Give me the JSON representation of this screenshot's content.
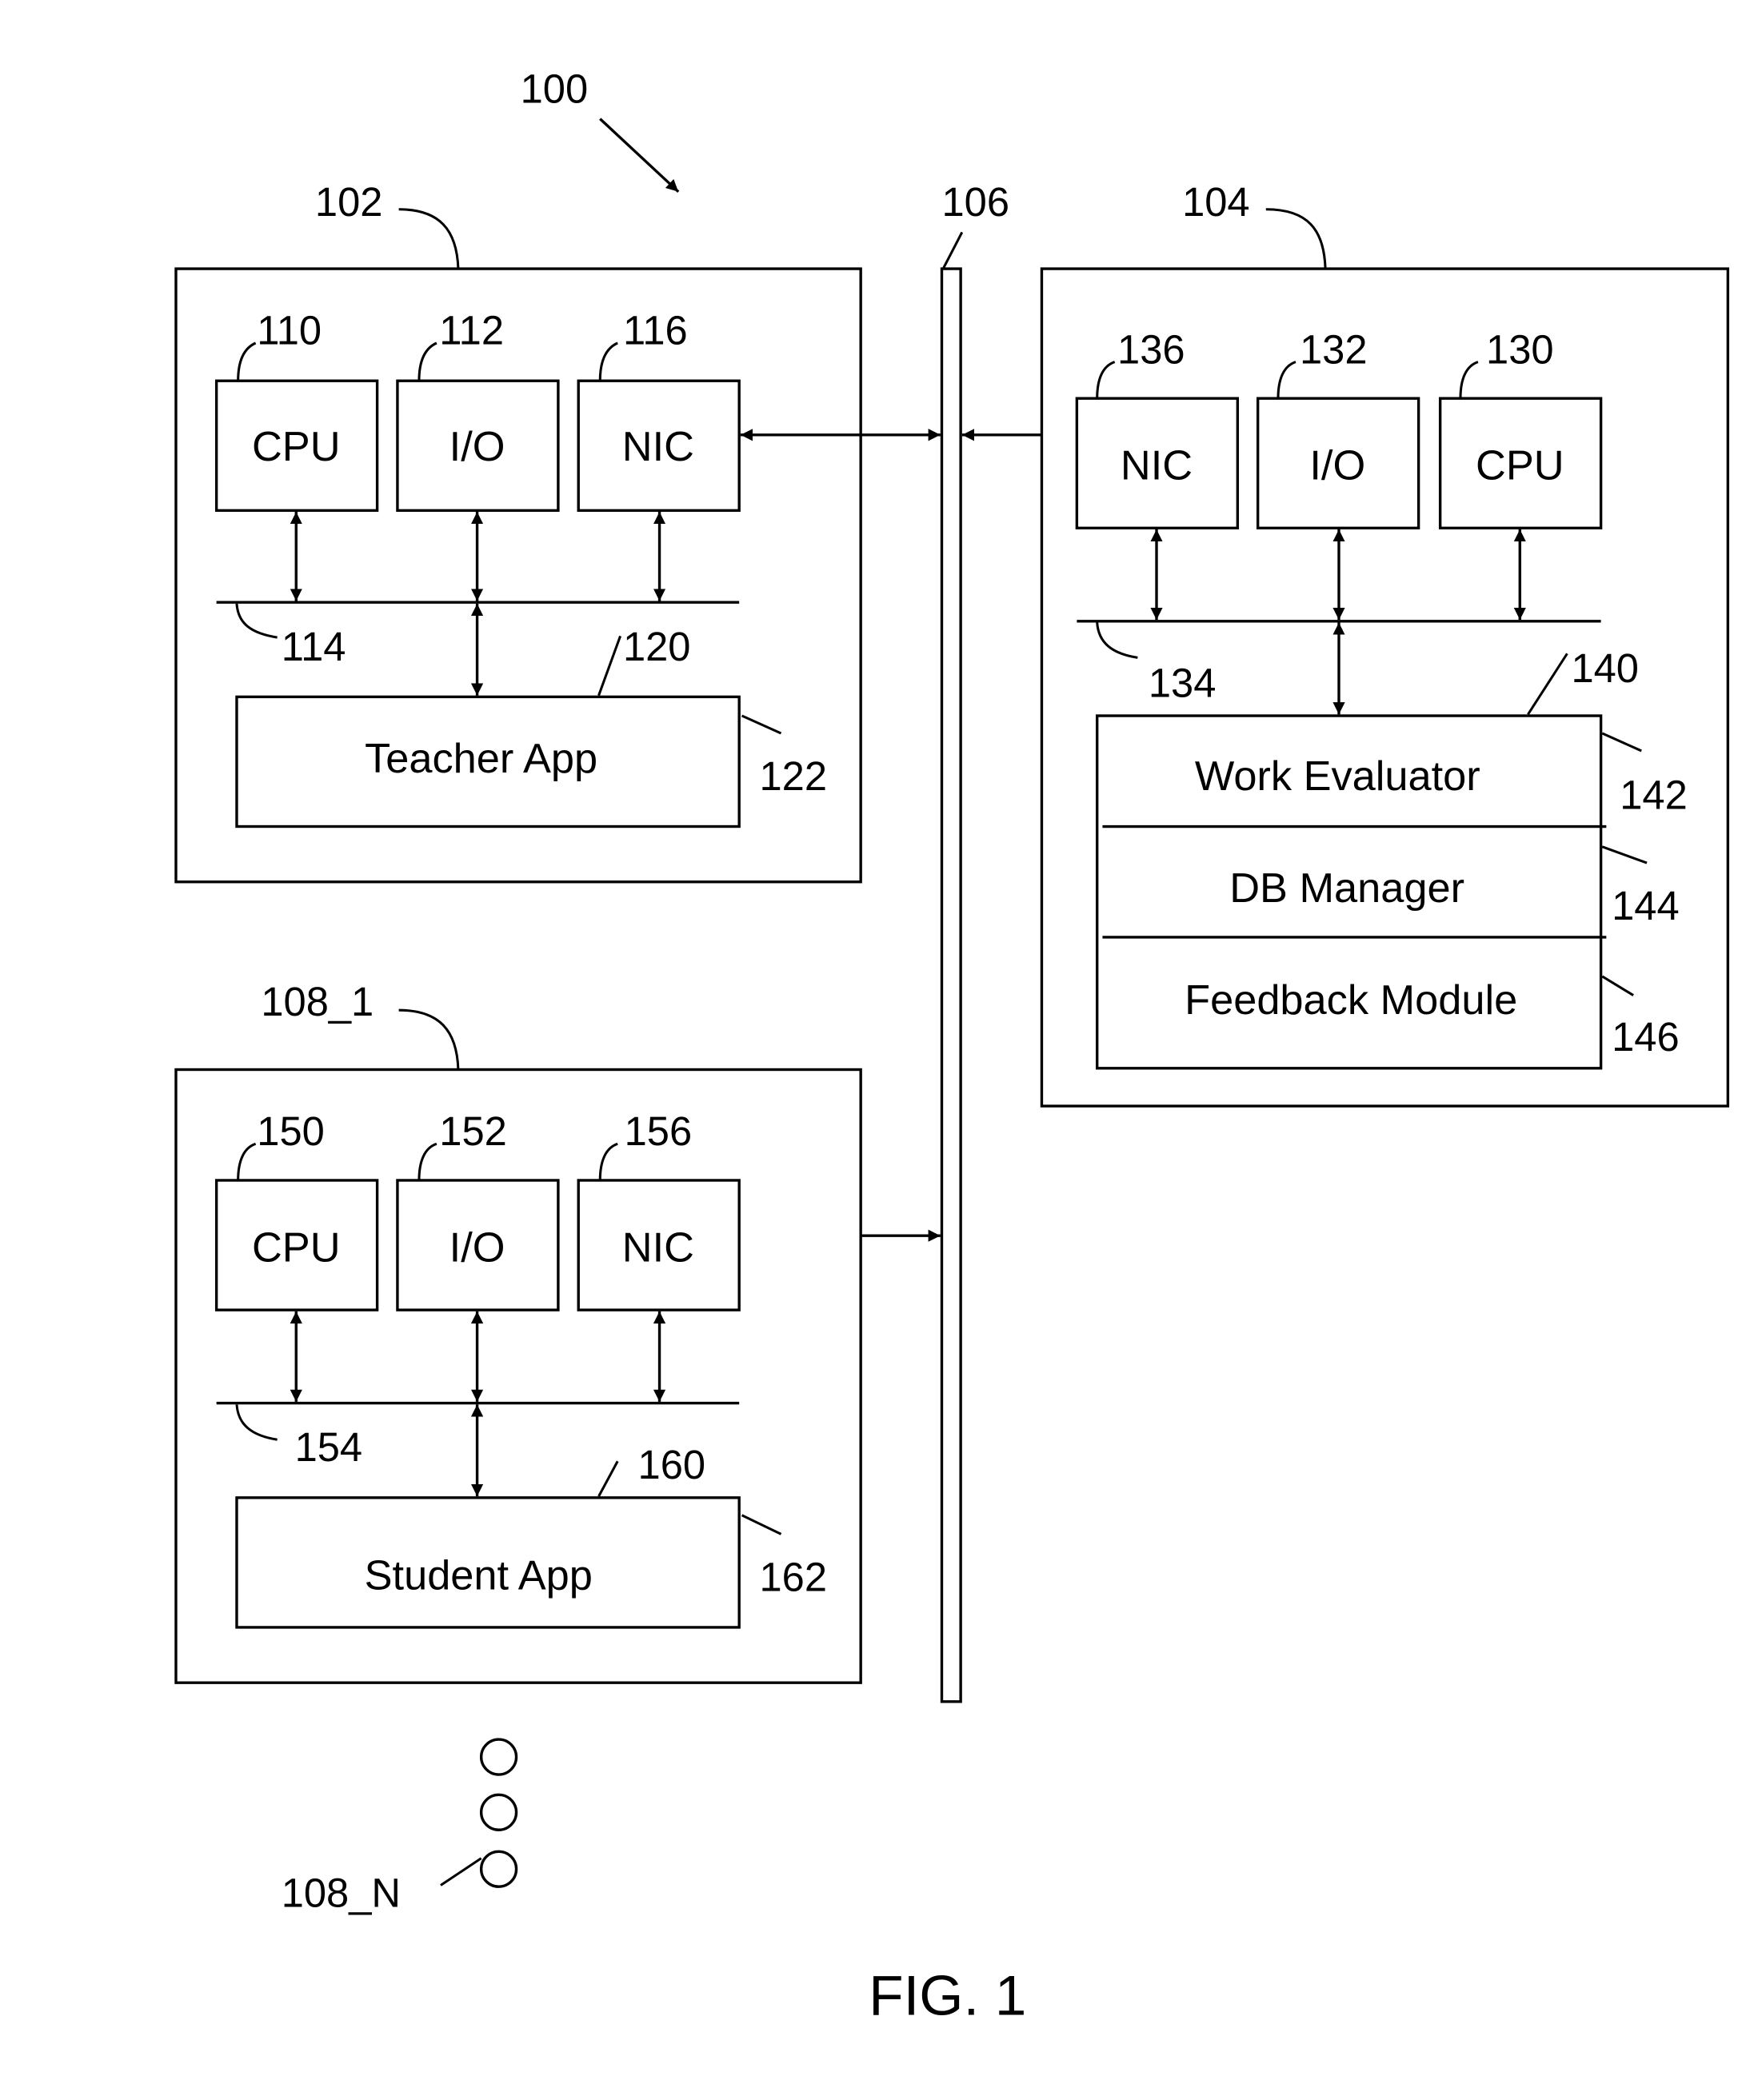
{
  "figure": {
    "caption": "FIG. 1",
    "system_ref": "100",
    "network": {
      "ref": "106"
    },
    "teacher_device": {
      "ref": "102",
      "components": [
        {
          "ref": "110",
          "label": "CPU"
        },
        {
          "ref": "112",
          "label": "I/O"
        },
        {
          "ref": "116",
          "label": "NIC"
        }
      ],
      "bus_ref": "114",
      "memory_ref": "120",
      "app": {
        "ref": "122",
        "label": "Teacher App"
      }
    },
    "server": {
      "ref": "104",
      "components": [
        {
          "ref": "136",
          "label": "NIC"
        },
        {
          "ref": "132",
          "label": "I/O"
        },
        {
          "ref": "130",
          "label": "CPU"
        }
      ],
      "bus_ref": "134",
      "memory_ref": "140",
      "modules": [
        {
          "ref": "142",
          "label": "Work Evaluator"
        },
        {
          "ref": "144",
          "label": "DB Manager"
        },
        {
          "ref": "146",
          "label": "Feedback Module"
        }
      ]
    },
    "student_device": {
      "ref": "108_1",
      "components": [
        {
          "ref": "150",
          "label": "CPU"
        },
        {
          "ref": "152",
          "label": "I/O"
        },
        {
          "ref": "156",
          "label": "NIC"
        }
      ],
      "bus_ref": "154",
      "memory_ref": "160",
      "app": {
        "ref": "162",
        "label": "Student App"
      }
    },
    "more_students": {
      "ref": "108_N",
      "ellipsis_count": 3
    }
  }
}
